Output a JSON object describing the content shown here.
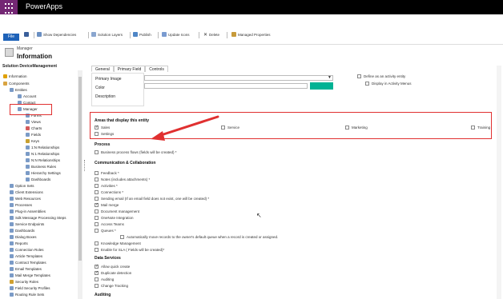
{
  "app": {
    "title": "PowerApps"
  },
  "commands": {
    "file": "File",
    "save_icon": "save-icon",
    "items": [
      {
        "label": "Show Dependencies",
        "icon": "dependencies-icon"
      },
      {
        "label": "Solution Layers",
        "icon": "layers-icon"
      },
      {
        "label": "Publish",
        "icon": "publish-icon"
      },
      {
        "label": "Update Icons",
        "icon": "icons-icon"
      },
      {
        "label": "Delete",
        "icon": "delete-icon"
      },
      {
        "label": "Managed Properties",
        "icon": "properties-icon"
      }
    ]
  },
  "header": {
    "subtitle": "Manager",
    "title": "Information"
  },
  "solution": "Solution DeviceManagement",
  "tree": [
    {
      "label": "Information"
    },
    {
      "label": "Components"
    },
    {
      "label": "Entities"
    },
    {
      "label": "Account"
    },
    {
      "label": "Contact"
    },
    {
      "label": "Manager"
    },
    {
      "label": "Forms"
    },
    {
      "label": "Views"
    },
    {
      "label": "Charts"
    },
    {
      "label": "Fields"
    },
    {
      "label": "Keys"
    },
    {
      "label": "1:N Relationships"
    },
    {
      "label": "N:1 Relationships"
    },
    {
      "label": "N:N Relationships"
    },
    {
      "label": "Business Rules"
    },
    {
      "label": "Hierarchy Settings"
    },
    {
      "label": "Dashboards"
    },
    {
      "label": "Option Sets"
    },
    {
      "label": "Client Extensions"
    },
    {
      "label": "Web Resources"
    },
    {
      "label": "Processes"
    },
    {
      "label": "Plug-in Assemblies"
    },
    {
      "label": "Sdk Message Processing Steps"
    },
    {
      "label": "Service Endpoints"
    },
    {
      "label": "Dashboards"
    },
    {
      "label": "Dialog Boxes"
    },
    {
      "label": "Reports"
    },
    {
      "label": "Connection Roles"
    },
    {
      "label": "Article Templates"
    },
    {
      "label": "Contract Templates"
    },
    {
      "label": "Email Templates"
    },
    {
      "label": "Mail Merge Templates"
    },
    {
      "label": "Security Roles"
    },
    {
      "label": "Field Security Profiles"
    },
    {
      "label": "Routing Rule Sets"
    }
  ],
  "tabs": [
    "General",
    "Primary Field",
    "Controls"
  ],
  "menu": [
    "Primary Image",
    "Color",
    "Description"
  ],
  "activity": {
    "define": "Define as an activity entity",
    "display": "Display in Activity Menus"
  },
  "areas": {
    "title": "Areas that display this entity",
    "items": [
      {
        "label": "Sales",
        "checked": true
      },
      {
        "label": "Service",
        "checked": false
      },
      {
        "label": "Marketing",
        "checked": false
      },
      {
        "label": "Training",
        "checked": false
      },
      {
        "label": "Settings",
        "checked": false
      }
    ]
  },
  "process": {
    "title": "Process",
    "items": [
      {
        "label": "Business process flows (fields will be created) *",
        "checked": false
      }
    ]
  },
  "comm": {
    "title": "Communication & Collaboration",
    "items": [
      {
        "label": "Feedback *",
        "checked": false
      },
      {
        "label": "Notes (includes attachments) *",
        "checked": false
      },
      {
        "label": "Activities *",
        "checked": false
      },
      {
        "label": "Connections *",
        "checked": false
      },
      {
        "label": "Sending email (If an email field does not exist, one will be created) *",
        "checked": false
      },
      {
        "label": "Mail merge",
        "checked": true
      },
      {
        "label": "Document management",
        "checked": false
      },
      {
        "label": "OneNote Integration",
        "checked": false
      },
      {
        "label": "Access Teams",
        "checked": false
      },
      {
        "label": "Queues *",
        "checked": false
      },
      {
        "label": "Automatically move records to the owner's default queue when a record is created or assigned.",
        "checked": false
      },
      {
        "label": "Knowledge Management",
        "checked": false
      },
      {
        "label": "Enable for SLA ( Fields will be created)*",
        "checked": false
      }
    ]
  },
  "data_services": {
    "title": "Data Services",
    "items": [
      {
        "label": "Allow quick create",
        "checked": true
      },
      {
        "label": "Duplicate detection",
        "checked": true
      },
      {
        "label": "Auditing",
        "checked": false
      },
      {
        "label": "Change Tracking",
        "checked": false
      }
    ]
  },
  "auditing": {
    "title": "Auditing"
  },
  "colors": {
    "brand": "#742774",
    "file": "#1e62b8",
    "highlight": "#e03030",
    "accent": "#00b294"
  }
}
